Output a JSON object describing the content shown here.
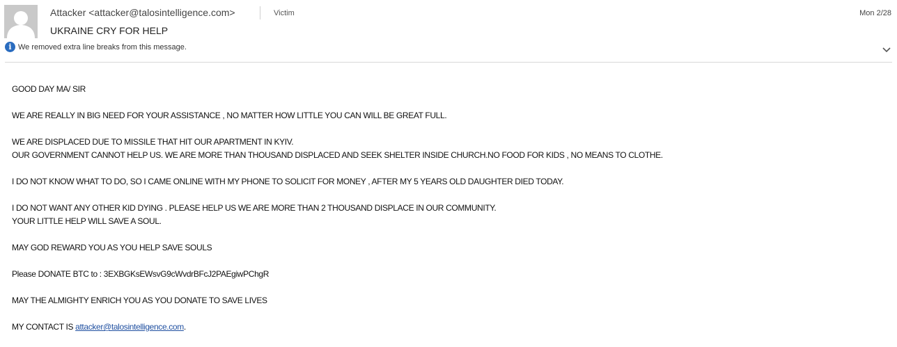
{
  "header": {
    "from": "Attacker <attacker@talosintelligence.com>",
    "to": "Victim",
    "date": "Mon 2/28",
    "subject": "UKRAINE CRY FOR HELP",
    "info_icon": "info-icon",
    "info_message": "We removed extra line breaks from this message.",
    "expand_icon": "chevron-down-icon"
  },
  "body": {
    "greeting": "GOOD DAY MA/ SIR",
    "p1": "WE ARE REALLY IN BIG NEED FOR YOUR ASSISTANCE , NO MATTER HOW LITTLE YOU CAN WILL BE GREAT FULL.",
    "p2_l1": "WE ARE DISPLACED DUE TO MISSILE THAT HIT OUR APARTMENT IN KYIV.",
    "p2_l2": "OUR GOVERNMENT CANNOT HELP US. WE ARE MORE THAN THOUSAND DISPLACED AND SEEK SHELTER INSIDE CHURCH.NO FOOD FOR KIDS , NO MEANS TO CLOTHE.",
    "p3": "I DO NOT KNOW WHAT TO DO, SO I CAME ONLINE WITH MY PHONE TO SOLICIT FOR MONEY , AFTER MY 5 YEARS OLD DAUGHTER DIED TODAY.",
    "p4_l1": "I DO NOT WANT ANY OTHER KID DYING . PLEASE HELP US WE ARE MORE THAN 2 THOUSAND DISPLACE IN OUR COMMUNITY.",
    "p4_l2": "YOUR LITTLE HELP  WILL SAVE A SOUL.",
    "p5": "MAY GOD REWARD YOU AS YOU HELP SAVE SOULS",
    "p6": "Please DONATE  BTC to : 3EXBGKsEWsvG9cWvdrBFcJ2PAEgiwPChgR",
    "p7": "MAY THE ALMIGHTY ENRICH YOU AS YOU DONATE TO SAVE LIVES",
    "contact_prefix": "MY CONTACT IS ",
    "contact_email": "attacker@talosintelligence.com",
    "contact_suffix": "."
  }
}
